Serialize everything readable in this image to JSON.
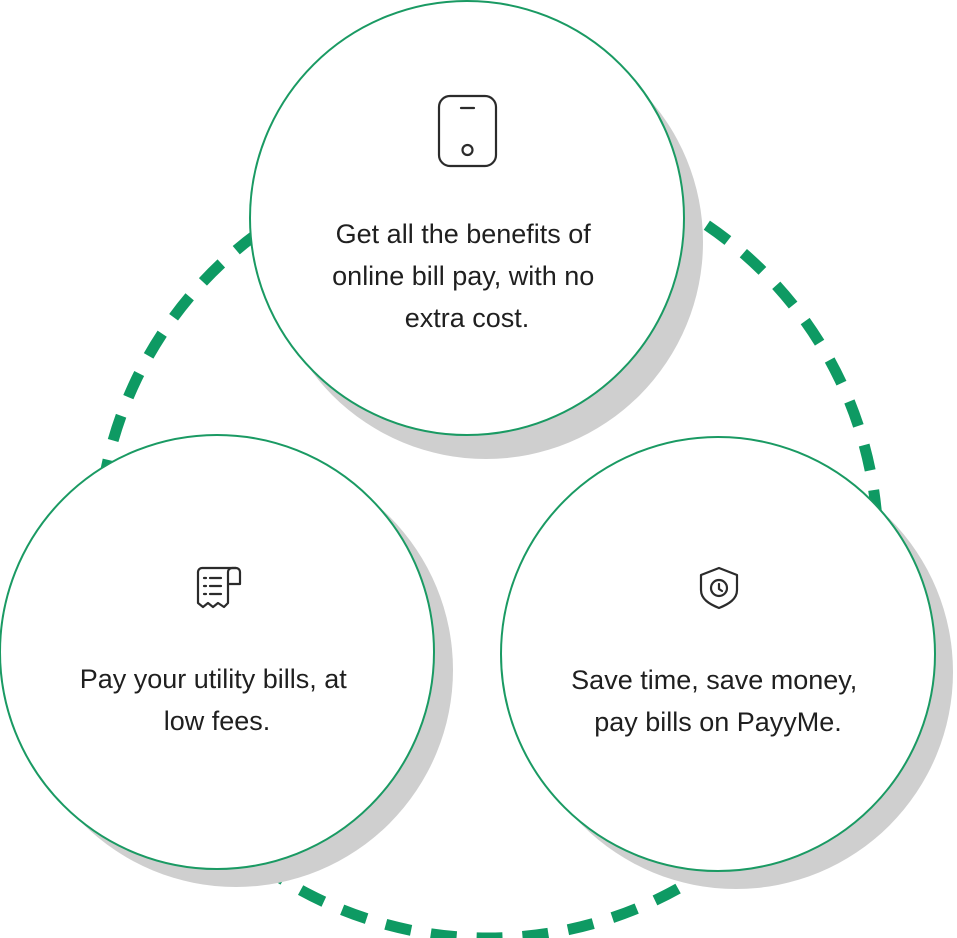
{
  "colors": {
    "accent": "#0e9a63",
    "circle_border": "#1a9a63",
    "shadow": "#cfcfcf",
    "icon_stroke": "#2b2b2b",
    "text": "#1f1f1f"
  },
  "cards": [
    {
      "icon": "phone-icon",
      "lines": [
        "Get all the benefits of",
        "online bill pay, with no",
        "extra cost."
      ]
    },
    {
      "icon": "receipt-icon",
      "lines": [
        "Pay your utility bills, at",
        "low  fees."
      ]
    },
    {
      "icon": "shield-clock-icon",
      "lines": [
        "Save time, save money,",
        "pay bills on PayyMe."
      ]
    }
  ]
}
